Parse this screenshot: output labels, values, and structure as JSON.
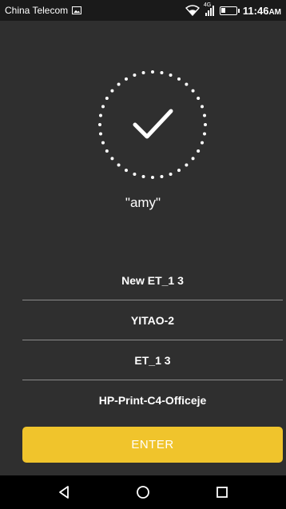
{
  "status_bar": {
    "carrier": "China Telecom",
    "network_type": "4G",
    "time": "11:46",
    "time_suffix": "AM"
  },
  "icons": [
    "image-icon",
    "wifi-icon",
    "signal-icon",
    "battery-icon",
    "checkmark-icon",
    "back-icon",
    "home-icon",
    "recents-icon"
  ],
  "connected": {
    "name": "\"amy\""
  },
  "networks": [
    {
      "name": "New ET_1 3"
    },
    {
      "name": "YITAO-2"
    },
    {
      "name": "ET_1 3"
    },
    {
      "name": "HP-Print-C4-Officeje"
    }
  ],
  "enter_label": "ENTER",
  "colors": {
    "background": "#2f2f2f",
    "accent": "#f0c42c",
    "divider": "#8a8a8a"
  }
}
